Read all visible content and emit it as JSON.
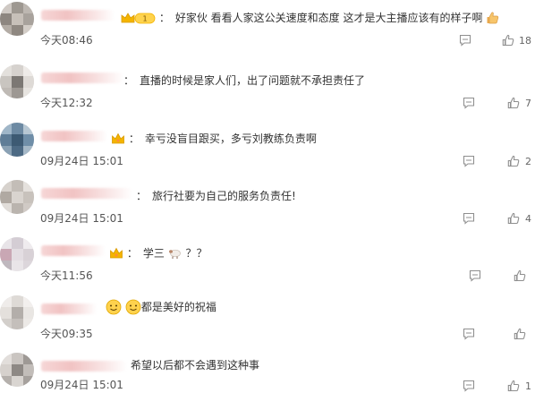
{
  "colors": {
    "text": "#333333",
    "time": "#555555",
    "icon": "#999999",
    "crown_gold": "#f4b400",
    "name_blur": "#f1c3c3"
  },
  "comments": [
    {
      "separator": "：",
      "text_before": "好家伙 看看人家这公关速度和态度 这才是大主播应该有的样子啊",
      "text_after": "",
      "time": "今天08:46",
      "likes": "18",
      "badge": "crown-level-icon",
      "badge_level": "1"
    },
    {
      "separator": "：",
      "text_before": "直播的时候是家人们，出了问题就不承担责任了",
      "text_after": "",
      "time": "今天12:32",
      "likes": "7",
      "badge": ""
    },
    {
      "separator": "：",
      "text_before": "幸亏没盲目跟买，多亏刘教练负责啊",
      "text_after": "",
      "time": "09月24日 15:01",
      "likes": "2",
      "badge": "crown-icon"
    },
    {
      "separator": "：",
      "text_before": "旅行社要为自己的服务负责任!",
      "text_after": "",
      "time": "09月24日 15:01",
      "likes": "4",
      "badge": ""
    },
    {
      "separator": "：",
      "text_before": "学三",
      "text_after": "？？",
      "time": "今天11:56",
      "likes": "",
      "badge": "crown-icon"
    },
    {
      "separator": "",
      "text_before": "",
      "text_after": "都是美好的祝福",
      "time": "今天09:35",
      "likes": "",
      "badge": ""
    },
    {
      "separator": "",
      "text_before": "",
      "text_after": "希望以后都不会遇到这种事",
      "time": "09月24日 15:01",
      "likes": "1",
      "badge": ""
    }
  ],
  "icons": {
    "reply": "comment-icon",
    "like": "thumbs-up-icon"
  }
}
